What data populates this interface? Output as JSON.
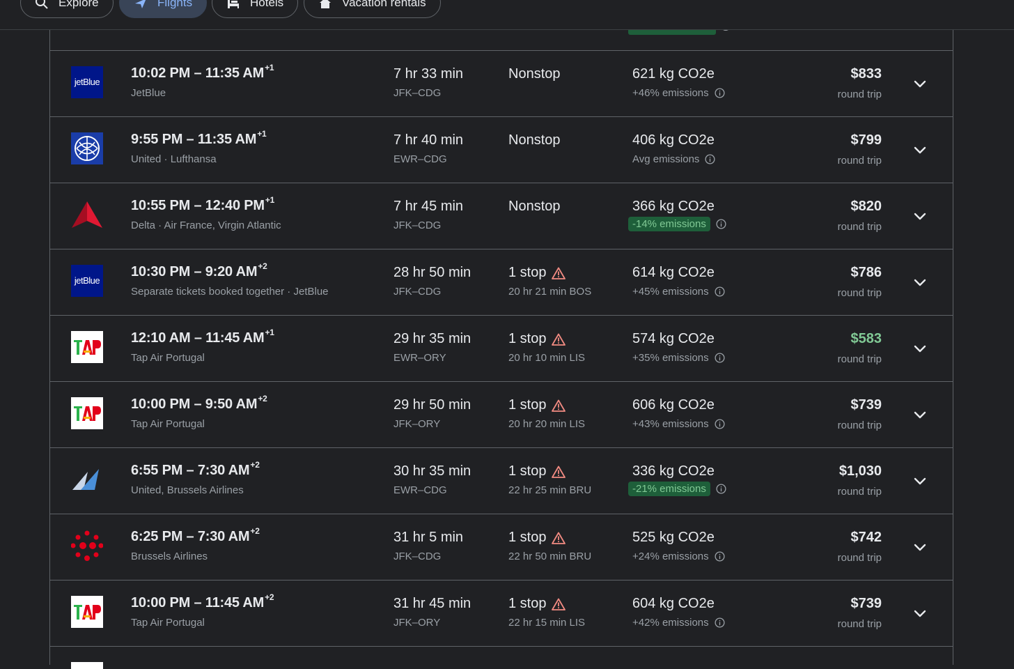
{
  "nav": {
    "tabs": [
      {
        "label": "Explore",
        "icon": "explore-icon",
        "active": false
      },
      {
        "label": "Flights",
        "icon": "airplane-icon",
        "active": true
      },
      {
        "label": "Hotels",
        "icon": "hotel-bed-icon",
        "active": false
      },
      {
        "label": "Vacation rentals",
        "icon": "house-icon",
        "active": false
      }
    ]
  },
  "colors": {
    "background": "#202124",
    "accent": "#8ab4f8",
    "green": "#81c995",
    "badge_bg": "#1e5f3a",
    "warning": "#f28b82"
  },
  "flights": [
    {
      "logo": "jetblue",
      "depart": "10:02 PM",
      "arrive": "11:35 AM",
      "day_offset": "+1",
      "airline": "JetBlue",
      "duration": "7 hr 33 min",
      "route": "JFK–CDG",
      "stops": "Nonstop",
      "layover": "",
      "warning": false,
      "co2": "621 kg CO2e",
      "emissions": "+46% emissions",
      "emissions_badge": false,
      "price": "$833",
      "price_low": false,
      "price_type": "round trip"
    },
    {
      "logo": "united",
      "depart": "9:55 PM",
      "arrive": "11:35 AM",
      "day_offset": "+1",
      "airline": "United · Lufthansa",
      "duration": "7 hr 40 min",
      "route": "EWR–CDG",
      "stops": "Nonstop",
      "layover": "",
      "warning": false,
      "co2": "406 kg CO2e",
      "emissions": "Avg emissions",
      "emissions_badge": false,
      "price": "$799",
      "price_low": false,
      "price_type": "round trip"
    },
    {
      "logo": "delta",
      "depart": "10:55 PM",
      "arrive": "12:40 PM",
      "day_offset": "+1",
      "airline": "Delta · Air France, Virgin Atlantic",
      "duration": "7 hr 45 min",
      "route": "JFK–CDG",
      "stops": "Nonstop",
      "layover": "",
      "warning": false,
      "co2": "366 kg CO2e",
      "emissions": "-14% emissions",
      "emissions_badge": true,
      "price": "$820",
      "price_low": false,
      "price_type": "round trip"
    },
    {
      "logo": "jetblue",
      "depart": "10:30 PM",
      "arrive": "9:20 AM",
      "day_offset": "+2",
      "airline": "Separate tickets booked together · JetBlue",
      "duration": "28 hr 50 min",
      "route": "JFK–CDG",
      "stops": "1 stop",
      "layover": "20 hr 21 min BOS",
      "warning": true,
      "co2": "614 kg CO2e",
      "emissions": "+45% emissions",
      "emissions_badge": false,
      "price": "$786",
      "price_low": false,
      "price_type": "round trip"
    },
    {
      "logo": "tap",
      "depart": "12:10 AM",
      "arrive": "11:45 AM",
      "day_offset": "+1",
      "airline": "Tap Air Portugal",
      "duration": "29 hr 35 min",
      "route": "EWR–ORY",
      "stops": "1 stop",
      "layover": "20 hr 10 min LIS",
      "warning": true,
      "co2": "574 kg CO2e",
      "emissions": "+35% emissions",
      "emissions_badge": false,
      "price": "$583",
      "price_low": true,
      "price_type": "round trip"
    },
    {
      "logo": "tap",
      "depart": "10:00 PM",
      "arrive": "9:50 AM",
      "day_offset": "+2",
      "airline": "Tap Air Portugal",
      "duration": "29 hr 50 min",
      "route": "JFK–ORY",
      "stops": "1 stop",
      "layover": "20 hr 20 min LIS",
      "warning": true,
      "co2": "606 kg CO2e",
      "emissions": "+43% emissions",
      "emissions_badge": false,
      "price": "$739",
      "price_low": false,
      "price_type": "round trip"
    },
    {
      "logo": "brussels-united",
      "depart": "6:55 PM",
      "arrive": "7:30 AM",
      "day_offset": "+2",
      "airline": "United, Brussels Airlines",
      "duration": "30 hr 35 min",
      "route": "EWR–CDG",
      "stops": "1 stop",
      "layover": "22 hr 25 min BRU",
      "warning": true,
      "co2": "336 kg CO2e",
      "emissions": "-21% emissions",
      "emissions_badge": true,
      "price": "$1,030",
      "price_low": false,
      "price_type": "round trip"
    },
    {
      "logo": "brussels",
      "depart": "6:25 PM",
      "arrive": "7:30 AM",
      "day_offset": "+2",
      "airline": "Brussels Airlines",
      "duration": "31 hr 5 min",
      "route": "JFK–CDG",
      "stops": "1 stop",
      "layover": "22 hr 50 min BRU",
      "warning": true,
      "co2": "525 kg CO2e",
      "emissions": "+24% emissions",
      "emissions_badge": false,
      "price": "$742",
      "price_low": false,
      "price_type": "round trip"
    },
    {
      "logo": "tap",
      "depart": "10:00 PM",
      "arrive": "11:45 AM",
      "day_offset": "+2",
      "airline": "Tap Air Portugal",
      "duration": "31 hr 45 min",
      "route": "JFK–ORY",
      "stops": "1 stop",
      "layover": "22 hr 15 min LIS",
      "warning": true,
      "co2": "604 kg CO2e",
      "emissions": "+42% emissions",
      "emissions_badge": false,
      "price": "$739",
      "price_low": false,
      "price_type": "round trip"
    }
  ],
  "prev_row_price_type": "round trip"
}
